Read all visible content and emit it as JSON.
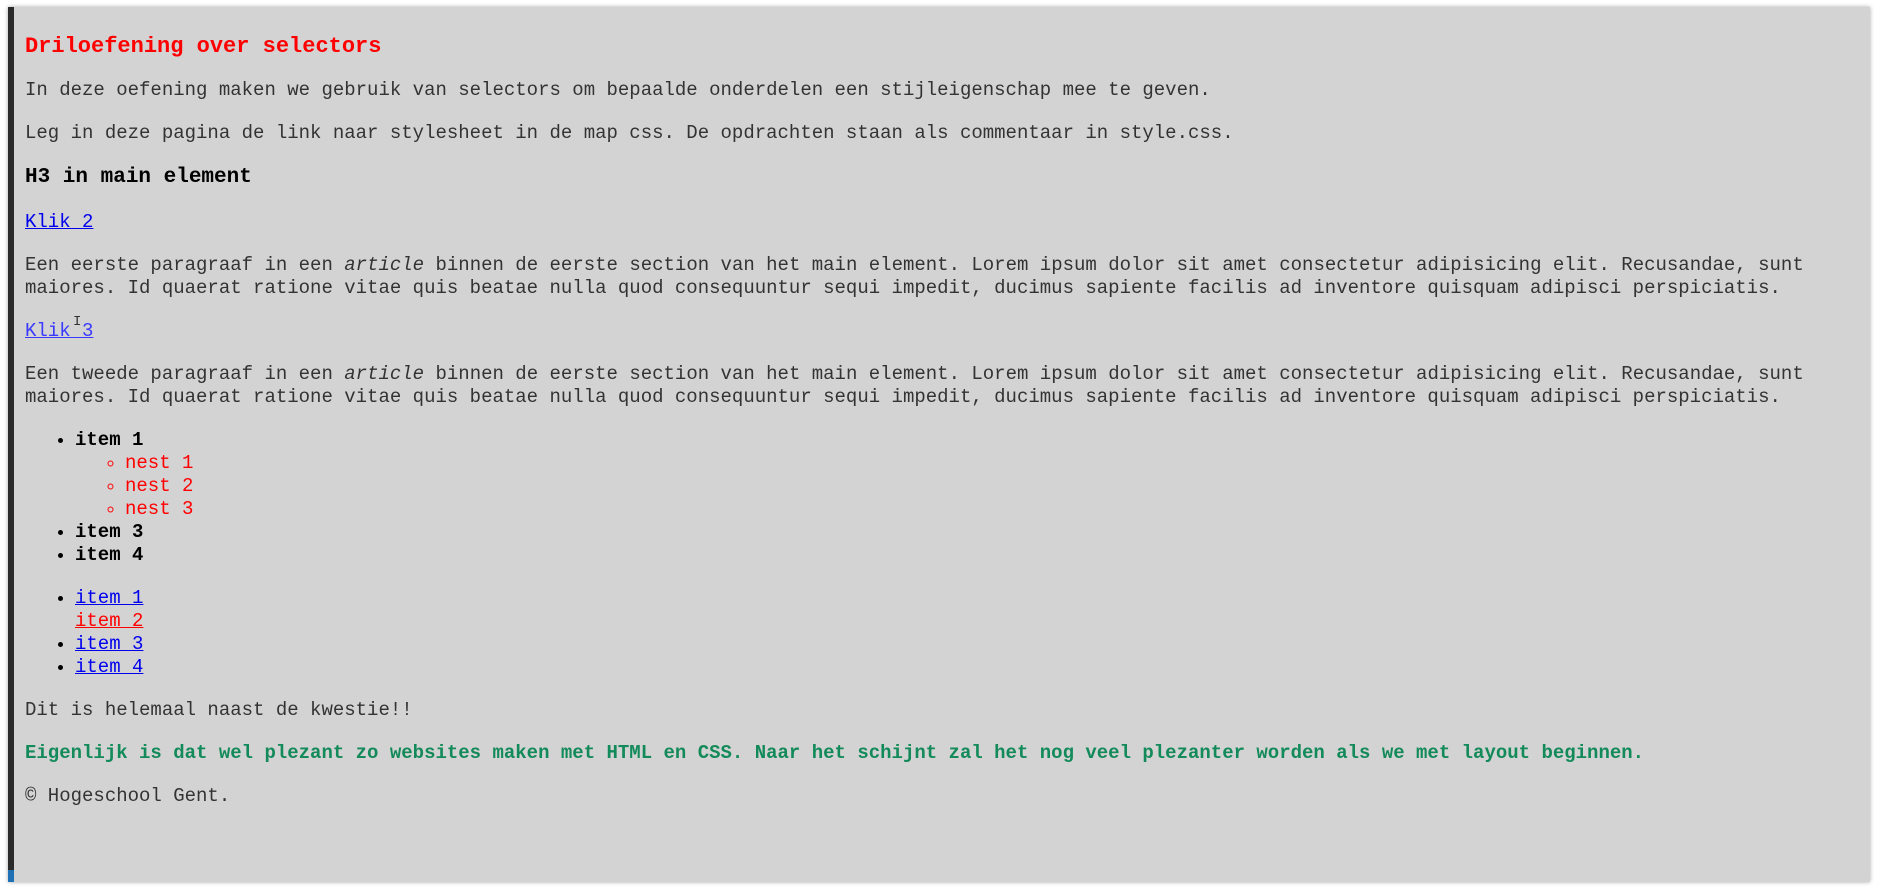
{
  "page": {
    "title": "Driloefening over selectors",
    "intro1": "In deze oefening maken we gebruik van selectors om bepaalde onderdelen een stijleigenschap mee te geven.",
    "intro2": "Leg in deze pagina de link naar stylesheet in de map css. De opdrachten staan als commentaar in style.css.",
    "heading3": "H3 in main element",
    "link_klik2": "Klik 2",
    "para1": {
      "before": "Een eerste paragraaf in een ",
      "em": "article",
      "after": " binnen de eerste section van het main element. Lorem ipsum dolor sit amet consectetur adipisicing elit. Recusandae, sunt maiores. Id quaerat ratione vitae quis beatae nulla quod consequuntur sequi impedit, ducimus sapiente facilis ad inventore quisquam adipisci perspiciatis."
    },
    "link_klik3": "Klik 3",
    "para2": {
      "before": "Een tweede paragraaf in een ",
      "em": "article",
      "after": " binnen de eerste section van het main element. Lorem ipsum dolor sit amet consectetur adipisicing elit. Recusandae, sunt maiores. Id quaerat ratione vitae quis beatae nulla quod consequuntur sequi impedit, ducimus sapiente facilis ad inventore quisquam adipisci perspiciatis."
    },
    "list1": {
      "item1": "item 1",
      "nested": [
        "nest 1",
        "nest 2",
        "nest 3"
      ],
      "item3": "item 3",
      "item4": "item 4"
    },
    "list2": [
      "item 1",
      "item 2",
      "item 3",
      "item 4"
    ],
    "aside": "Dit is helemaal naast de kwestie!!",
    "green": "Eigenlijk is dat wel plezant zo websites maken met HTML en CSS. Naar het schijnt zal het nog veel plezanter worden als we met layout beginnen.",
    "footer": "© Hogeschool Gent."
  },
  "colors": {
    "background": "#d3d3d3",
    "title": "#ff0000",
    "link": "#0000ee",
    "nested": "#ff0000",
    "green": "#138a5a"
  },
  "icons": {
    "cursor": "text-cursor-icon"
  }
}
